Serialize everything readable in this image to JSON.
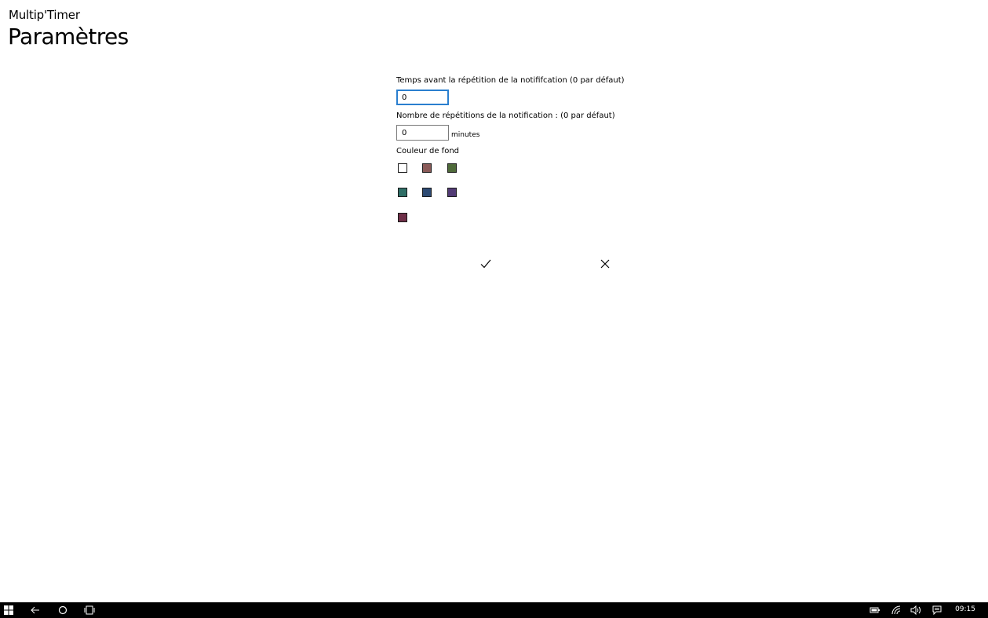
{
  "header": {
    "app_name": "Multip'Timer",
    "page_title": "Paramètres"
  },
  "settings": {
    "repeat_delay": {
      "label": "Temps avant la répétition de la notififcation (0 par défaut)",
      "value": "0"
    },
    "repeat_count": {
      "label": "Nombre de répétitions de la notification : (0 par défaut)",
      "value": "0",
      "units": "minutes"
    },
    "background": {
      "label": "Couleur de fond",
      "colors": [
        "#ffffff",
        "#8a5a58",
        "#4f6b3a",
        "#2f6e66",
        "#2d4a73",
        "#523b75",
        "#6e2f48"
      ]
    }
  },
  "actions": {
    "confirm_icon": "checkmark-icon",
    "cancel_icon": "close-icon"
  },
  "taskbar": {
    "icons": [
      "windows-start-icon",
      "back-icon",
      "cortana-icon",
      "task-view-icon",
      "battery-icon",
      "wifi-icon",
      "volume-icon",
      "notifications-icon"
    ],
    "clock": "09:15"
  }
}
